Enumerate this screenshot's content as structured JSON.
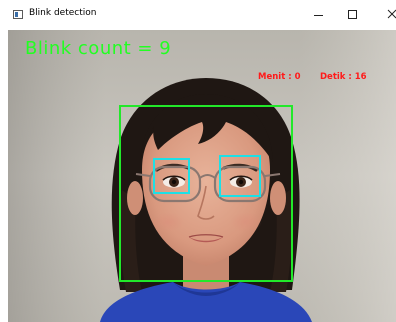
{
  "window": {
    "title": "Blink detection"
  },
  "overlay": {
    "blink_count_text": "Blink count = 9",
    "menit_text": "Menit : 0",
    "detik_text": "Detik : 16"
  },
  "icons": {
    "app": "app-window-icon",
    "minimize": "minimize-icon",
    "maximize": "maximize-icon",
    "close": "close-icon"
  },
  "colors": {
    "blink_text": "#22ff22",
    "timer_text": "#ff1a1a",
    "face_box": "#22e82a",
    "eye_box": "#1de0e6"
  }
}
